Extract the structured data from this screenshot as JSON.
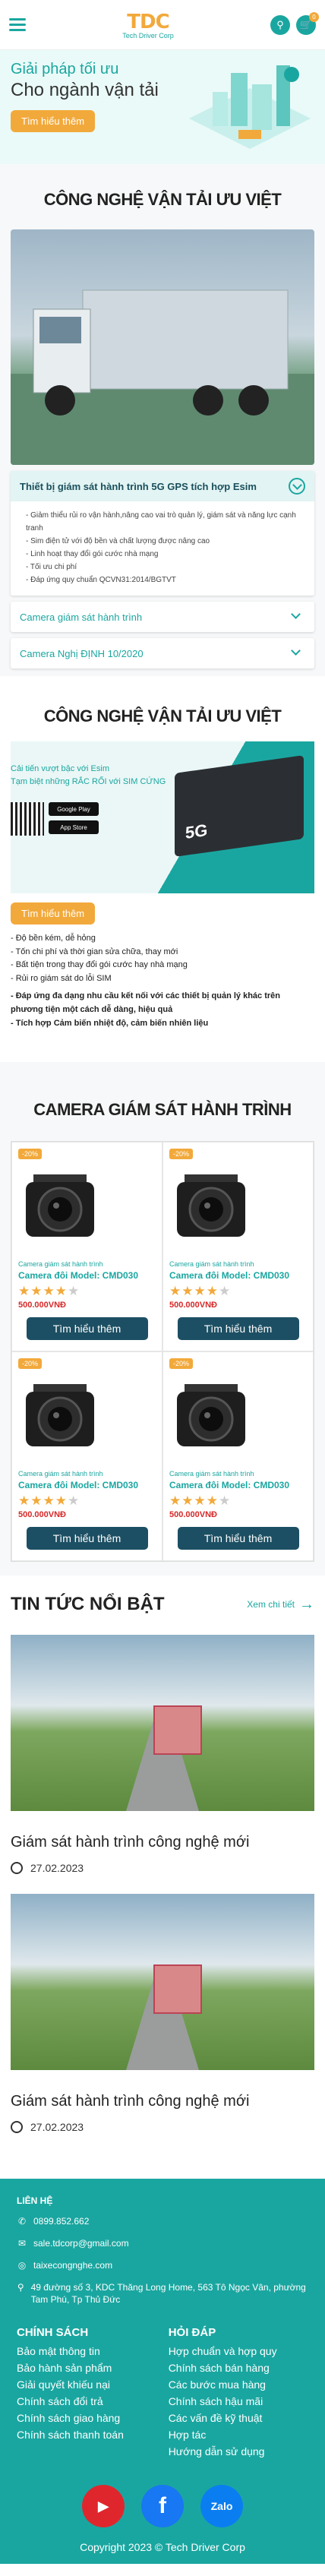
{
  "header": {
    "logo_text": "Tech Driver Corp",
    "logo_mark": "TDC",
    "cart_count": "0"
  },
  "hero": {
    "line1": "Giải pháp tối ưu",
    "line2": "Cho ngành vận tải",
    "cta": "Tìm hiểu thêm"
  },
  "section1": {
    "title": "CÔNG NGHỆ VẬN TẢI ƯU VIỆT",
    "accordions": [
      {
        "title": "Thiết bị giám sát hành trình 5G GPS tích hợp Esim",
        "items": [
          "- Giảm thiểu rủi ro vận hành,nâng cao vai trò quản lý, giám sát và năng lực cạnh tranh",
          "- Sim điện tử với độ bền và chất lượng được nâng cao",
          "- Linh hoạt thay đổi gói cước nhà mạng",
          "- Tối ưu chi phí",
          "- Đáp ứng quy chuẩn QCVN31:2014/BGTVT"
        ]
      },
      {
        "title": "Camera giám sát hành trình"
      },
      {
        "title": "Camera Nghị ĐỊNH 10/2020"
      }
    ]
  },
  "section2": {
    "title": "CÔNG NGHỆ VẬN TẢI ƯU VIỆT",
    "line1": "Cải tiến vượt bậc với Esim",
    "line2": "Tạm biệt những RẮC RỐI với SIM CỨNG",
    "google_play": "Google Play",
    "app_store": "App Store",
    "device_label": "5G",
    "cta": "Tìm hiểu thêm",
    "bullets": [
      "- Độ bền kém, dễ hỏng",
      "- Tốn chi phí và thời gian sửa chữa, thay mới",
      "- Bất tiện trong thay đổi gói cước hay nhà mạng",
      "- Rủi ro giám sát do lỗi SIM"
    ],
    "bold_bullets": [
      "- Đáp ứng đa dạng nhu cầu kết nối với các thiết bị quản lý khác trên phương tiện một cách dễ dàng, hiệu quả",
      "- Tích hợp Cảm biến nhiệt độ, cảm biến nhiên liệu"
    ]
  },
  "section3": {
    "title": "CAMERA GIÁM SÁT HÀNH TRÌNH",
    "products": [
      {
        "sale": "-20%",
        "category": "Camera giám sát hành trình",
        "name": "Camera đôi Model: CMD030",
        "rating": 4,
        "price": "500.000VNĐ",
        "cta": "Tìm hiểu thêm"
      },
      {
        "sale": "-20%",
        "category": "Camera giám sát hành trình",
        "name": "Camera đôi Model: CMD030",
        "rating": 4,
        "price": "500.000VNĐ",
        "cta": "Tìm hiểu thêm"
      },
      {
        "sale": "-20%",
        "category": "Camera giám sát hành trình",
        "name": "Camera đôi Model: CMD030",
        "rating": 4,
        "price": "500.000VNĐ",
        "cta": "Tìm hiểu thêm"
      },
      {
        "sale": "-20%",
        "category": "Camera giám sát hành trình",
        "name": "Camera đôi Model: CMD030",
        "rating": 4,
        "price": "500.000VNĐ",
        "cta": "Tìm hiểu thêm"
      }
    ]
  },
  "news": {
    "title": "TIN TỨC NỔI BẬT",
    "more": "Xem chi tiết",
    "items": [
      {
        "title": "Giám sát hành trình công nghệ mới",
        "date": "27.02.2023"
      },
      {
        "title": "Giám sát hành trình công nghệ mới",
        "date": "27.02.2023"
      }
    ]
  },
  "footer": {
    "contact_title": "LIÊN HỆ",
    "phone": "0899.852.662",
    "email": "sale.tdcorp@gmail.com",
    "website": "taixecongnghe.com",
    "address": "49 đường số 3, KDC Thăng Long Home, 563 Tô Ngọc Vân, phường Tam Phú, Tp Thủ Đức",
    "policy_title": "CHÍNH SÁCH",
    "policies": [
      "Bảo mật thông tin",
      "Bảo hành sản phẩm",
      "Giải quyết khiếu nại",
      "Chính sách đổi trả",
      "Chính sách giao hàng",
      "Chính sách thanh toán"
    ],
    "faq_title": "HỎI ĐÁP",
    "faqs": [
      "Hợp chuẩn và hợp quy",
      "Chính sách bán hàng",
      "Các bước mua hàng",
      "Chính sách hậu mãi",
      "Các vấn đề kỹ thuật",
      "Hợp tác",
      "Hướng dẫn sử dụng"
    ],
    "zalo": "Zalo",
    "copyright": "Copyright 2023 © Tech Driver Corp"
  },
  "colors": {
    "accent": "#1aa6a0",
    "orange": "#f2a93b",
    "dark_button": "#1c4f63",
    "price": "#d62828"
  }
}
